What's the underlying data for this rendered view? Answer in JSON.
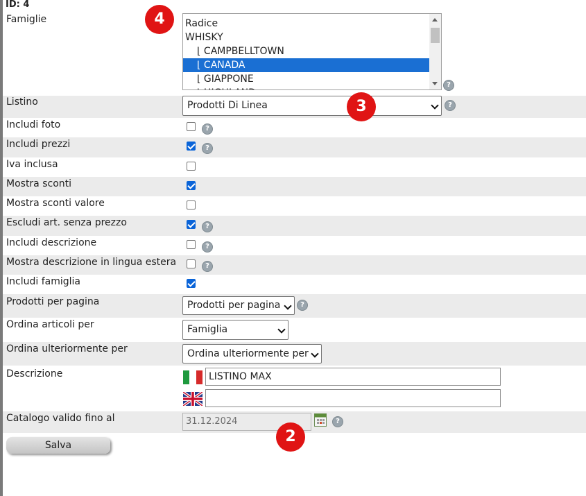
{
  "header": {
    "id_label": "ID: 4"
  },
  "famiglie": {
    "label": "Famiglie",
    "options": [
      {
        "text": "Radice",
        "level": 0,
        "selected": false
      },
      {
        "text": "WHISKY",
        "level": 0,
        "selected": false
      },
      {
        "text": "⌊ CAMPBELLTOWN",
        "level": 1,
        "selected": false
      },
      {
        "text": "⌊ CANADA",
        "level": 1,
        "selected": true
      },
      {
        "text": "⌊ GIAPPONE",
        "level": 1,
        "selected": false
      },
      {
        "text": "⌊ HIGHLAND",
        "level": 1,
        "selected": false
      }
    ]
  },
  "listino": {
    "label": "Listino",
    "value": "Prodotti Di Linea"
  },
  "checkboxes": [
    {
      "label": "Includi foto",
      "checked": false,
      "help": true
    },
    {
      "label": "Includi prezzi",
      "checked": true,
      "help": true
    },
    {
      "label": "Iva inclusa",
      "checked": false,
      "help": false
    },
    {
      "label": "Mostra sconti",
      "checked": true,
      "help": false
    },
    {
      "label": "Mostra sconti valore",
      "checked": false,
      "help": false
    },
    {
      "label": "Escludi art. senza prezzo",
      "checked": true,
      "help": true
    },
    {
      "label": "Includi descrizione",
      "checked": false,
      "help": true
    },
    {
      "label": "Mostra descrizione in lingua estera",
      "checked": false,
      "help": true
    },
    {
      "label": "Includi famiglia",
      "checked": true,
      "help": false
    }
  ],
  "prodotti_per_pagina": {
    "label": "Prodotti per pagina",
    "value": "Prodotti per pagina"
  },
  "ordina_articoli": {
    "label": "Ordina articoli per",
    "value": "Famiglia"
  },
  "ordina_ulteriormente": {
    "label": "Ordina ulteriormente per",
    "value": "Ordina ulteriormente per"
  },
  "descrizione": {
    "label": "Descrizione",
    "it_value": "LISTINO MAX",
    "en_value": ""
  },
  "catalogo": {
    "label": "Catalogo valido fino al",
    "value": "31.12.2024"
  },
  "help_glyph": "?",
  "save_label": "Salva",
  "annotations": {
    "a4": "4",
    "a3": "3",
    "a2": "2"
  },
  "colors": {
    "accent": "#0a64d8",
    "selection": "#1a6fd3",
    "badge": "#e01414",
    "row_shade": "#ebebeb"
  }
}
